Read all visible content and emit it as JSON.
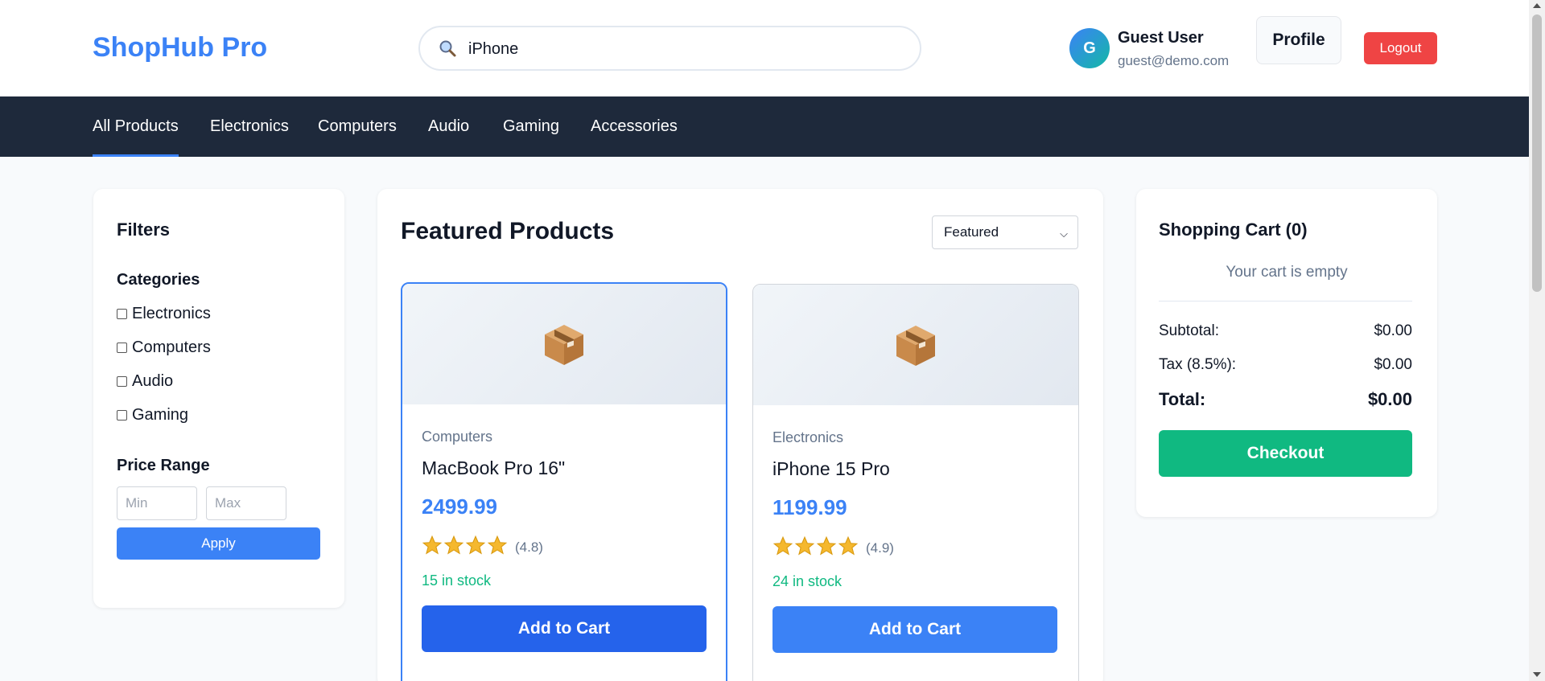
{
  "header": {
    "brand": "ShopHub Pro",
    "search": {
      "value": "iPhone",
      "icon": "search-icon"
    },
    "user": {
      "initial": "G",
      "name": "Guest User",
      "email": "guest@demo.com"
    },
    "profile_label": "Profile",
    "logout_label": "Logout"
  },
  "nav": {
    "items": [
      {
        "label": "All Products",
        "active": true
      },
      {
        "label": "Electronics"
      },
      {
        "label": "Computers"
      },
      {
        "label": "Audio"
      },
      {
        "label": "Gaming"
      },
      {
        "label": "Accessories"
      }
    ]
  },
  "filters": {
    "title": "Filters",
    "categories_label": "Categories",
    "categories": [
      "Electronics",
      "Computers",
      "Audio",
      "Gaming"
    ],
    "price_range_label": "Price Range",
    "min_placeholder": "Min",
    "max_placeholder": "Max",
    "apply_label": "Apply"
  },
  "products": {
    "title": "Featured Products",
    "sort": {
      "selected": "Featured"
    },
    "items": [
      {
        "category": "Computers",
        "name": "MacBook Pro 16\"",
        "price": "2499.99",
        "stars": 4,
        "rating": "(4.8)",
        "stock": "15 in stock",
        "add_label": "Add to Cart",
        "image_icon": "package-icon"
      },
      {
        "category": "Electronics",
        "name": "iPhone 15 Pro",
        "price": "1199.99",
        "stars": 4,
        "rating": "(4.9)",
        "stock": "24 in stock",
        "add_label": "Add to Cart",
        "image_icon": "package-icon"
      }
    ]
  },
  "cart": {
    "title": "Shopping Cart (0)",
    "empty_text": "Your cart is empty",
    "subtotal_label": "Subtotal:",
    "subtotal_value": "$0.00",
    "tax_label": "Tax (8.5%):",
    "tax_value": "$0.00",
    "total_label": "Total:",
    "total_value": "$0.00",
    "checkout_label": "Checkout"
  },
  "colors": {
    "brand": "#3b82f6",
    "nav_bg": "#1e293b",
    "logout": "#ef4444",
    "checkout": "#10b981",
    "stock": "#10b981"
  }
}
